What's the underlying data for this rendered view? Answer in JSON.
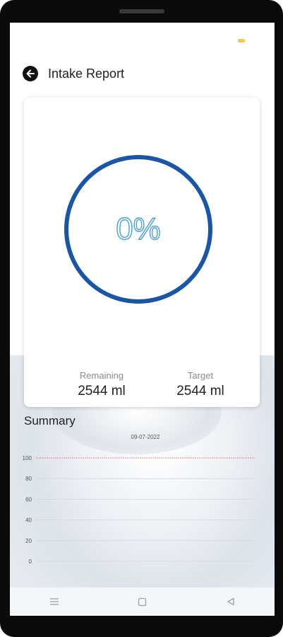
{
  "header": {
    "title": "Intake Report",
    "back_icon": "arrow-left-icon"
  },
  "progress": {
    "percent_label": "0%",
    "percent": 0,
    "ring_color": "#1a56a7"
  },
  "stats": {
    "remaining": {
      "label": "Remaining",
      "value": "2544 ml"
    },
    "target": {
      "label": "Target",
      "value": "2544 ml"
    }
  },
  "summary": {
    "title": "Summary",
    "chart_data": {
      "type": "bar",
      "categories": [
        "09-07-2022"
      ],
      "values": [
        0
      ],
      "y_ticks": [
        "100",
        "80",
        "60",
        "40",
        "20",
        "0"
      ],
      "ylim": [
        0,
        100
      ],
      "reference_line": 100,
      "reference_color": "#e06666",
      "grid": true
    }
  },
  "navbar": {
    "items": [
      "menu-icon",
      "home-square-icon",
      "back-triangle-icon"
    ]
  },
  "colors": {
    "accent": "#1a56a7",
    "percent_text": "#4a9fdc",
    "status_indicator": "#f2c94c"
  }
}
